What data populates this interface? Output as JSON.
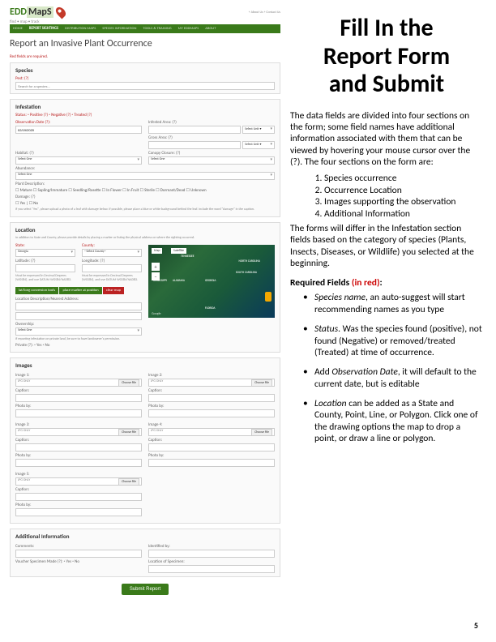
{
  "left": {
    "logo_edd": "EDD",
    "logo_maps": "MapS",
    "tagline": "find • map • track",
    "topnav_small": "+ About Us   + Contact Us",
    "nav": [
      "HOME",
      "REPORT SIGHTINGS",
      "DISTRIBUTION MAPS",
      "SPECIES INFORMATION",
      "TOOLS & TRAINING",
      "MY EDDMAPS",
      "ABOUT"
    ],
    "page_title": "Report an Invasive Plant Occurrence",
    "red_req": "Red fields are required.",
    "species_hdr": "Species",
    "pest_lbl": "Pest: (?)",
    "pest_ph": "Search for a species…",
    "infest_hdr": "Infestation",
    "status_lbl": "Status: ◦ Positive (?) ◦ Negative (?) ◦ Treated (?)",
    "obsdate_lbl": "Observation Date (?):",
    "obsdate_val": "02/19/2020",
    "infarea_lbl": "Infested Area: (?)",
    "grossarea_lbl": "Gross Area: (?)",
    "unit_ph": "Select Unit ▾",
    "habitat_lbl": "Habitat: (?)",
    "canopy_lbl": "Canopy Closure: (?)",
    "selectone": "Select One",
    "abund_lbl": "Abundance:",
    "plantdesc_lbl": "Plant Description:",
    "pd_opts": "☐ Mature  ☐ Sapling/Immature  ☐ Seedling/Rosette  ☐ In Flower  ☐ In Fruit  ☐ Sterile  ☐ Dormant/Dead  ☐ Unknown",
    "damage_lbl": "Damage: (?)",
    "dmg_opts": "☐ Yes  |  ☐ No",
    "dmg_note": "If you select \"Yes\", please upload a photo of a leaf with damage below. If possible, please place a blue or white background behind the leaf. Include the word \"damage\" in the caption.",
    "location_hdr": "Location",
    "loc_note": "In addition to State and County, please provide details by placing a marker or listing the physical address on where the sighting occurred.",
    "state_lbl": "State:",
    "state_val": "Georgia",
    "county_lbl": "County:",
    "county_val": "--Select County--",
    "lat_lbl": "Latitude: (?)",
    "lon_lbl": "Longitude: (?)",
    "latlon_note": "Must be expressed in Decimal Degrees (WGS84), and use DATUM WGS84/NAD83.",
    "btn_conv": "lat/long conversion tools",
    "btn_place": "place marker at position",
    "btn_clear": "clear map",
    "locdesc_lbl": "Location Description/Nearest Address:",
    "owner_lbl": "Ownership:",
    "owner_note": "If reporting infestation on private land, be sure to have landowner's permission.",
    "private_lbl": "Private (?): ◦ Yes  ◦ No",
    "map_btn_map": "Map",
    "map_btn_sat": "Satellite",
    "map_goog": "Google",
    "map_states": [
      "TENNESSEE",
      "NORTH CAROLINA",
      "SOUTH CAROLINA",
      "ALABAMA",
      "GEORGIA",
      "MISSISSIPPI",
      "FLORIDA"
    ],
    "images_hdr": "Images",
    "img1_lbl": "Image 1:",
    "img2_lbl": "Image 2:",
    "img3_lbl": "Image 3:",
    "img4_lbl": "Image 4:",
    "img5_lbl": "Image 5:",
    "jpg_only": "JPG ONLY",
    "choose": "Choose file",
    "caption_lbl": "Caption:",
    "photoby_lbl": "Photo by:",
    "addl_hdr": "Additional Information",
    "comments_lbl": "Comments:",
    "identby_lbl": "Identified by:",
    "voucher_lbl": "Voucher Specimen Made (?): ◦ Yes  ◦ No",
    "specloc_lbl": "Location of Specimen:",
    "submit": "Submit Report"
  },
  "right": {
    "title_l1": "Fill In the",
    "title_l2": "Report Form",
    "title_l3": "and Submit",
    "para1": "The data fields are divided into four sections on the form; some field names have additional information associated with them that can be viewed by hovering your mouse cursor over the (?). The four sections on the form are:",
    "list": [
      "Species occurrence",
      "Occurrence Location",
      "Images supporting the observation",
      "Additional Information"
    ],
    "para2": "The forms will differ in the Infestation section fields based on the category of species (Plants, Insects, Diseases, or Wildlife) you selected at the beginning.",
    "reqhdr_a": "Required Fields ",
    "reqhdr_b": "(in red)",
    "reqhdr_c": ":",
    "b1_a": "Species name",
    "b1_b": ", an auto-suggest will start recommending names as you type",
    "b2_a": "Status",
    "b2_b": ". Was the species found (positive), not found (Negative) or removed/treated (Treated) at time of occurrence.",
    "b3_a": "Add ",
    "b3_b": "Observation Date",
    "b3_c": ", it will default to the current date, but is editable",
    "b4_a": "Location",
    "b4_b": " can be added as a State and County, Point, Line, or Polygon. Click one of the drawing options the map to drop a point, or draw a line or polygon."
  },
  "pagenum": "5"
}
